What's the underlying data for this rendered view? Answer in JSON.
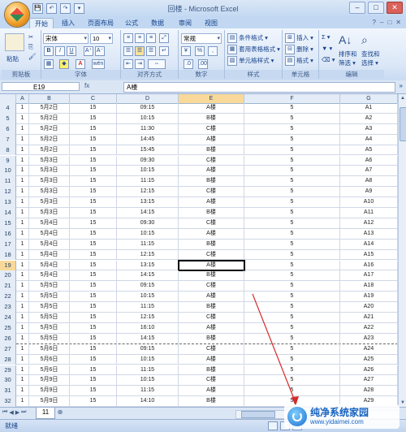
{
  "window": {
    "title": "回楼 - Microsoft Excel"
  },
  "qat": [
    "💾",
    "↶",
    "↷",
    "▾"
  ],
  "window_buttons": [
    "–",
    "□",
    "✕"
  ],
  "tabs": [
    "开始",
    "插入",
    "页面布局",
    "公式",
    "数据",
    "审阅",
    "视图"
  ],
  "active_tab": "开始",
  "tab_icons": [
    "?",
    "–",
    "□",
    "✕"
  ],
  "ribbon": {
    "clipboard": {
      "label": "剪贴板",
      "paste": "粘贴"
    },
    "font": {
      "label": "字体",
      "font_name": "宋体",
      "font_size": "10",
      "bold": "B",
      "italic": "I",
      "underline": "U",
      "grow": "A⁺",
      "shrink": "A⁻",
      "font_color": "A",
      "pinyin": "wén"
    },
    "alignment": {
      "label": "对齐方式"
    },
    "number": {
      "label": "数字",
      "format": "常规",
      "percent": "%",
      "comma": ","
    },
    "styles": {
      "label": "样式",
      "conditional": "条件格式 ▾",
      "table": "套用表格格式 ▾",
      "cell_styles": "单元格样式 ▾"
    },
    "cells": {
      "label": "单元格",
      "insert": "插入 ▾",
      "delete": "删除 ▾",
      "format": "格式 ▾"
    },
    "editing": {
      "label": "编辑",
      "sum": "Σ ▾",
      "sort": "排序和\n筛选 ▾",
      "find": "查找和\n选择 ▾",
      "sort_l1": "排序和",
      "sort_l2": "筛选 ▾",
      "find_l1": "查找和",
      "find_l2": "选择 ▾"
    }
  },
  "formula_bar": {
    "name_box": "E19",
    "fx": "fx",
    "content": "A楼"
  },
  "columns": [
    "A",
    "B",
    "C",
    "D",
    "E",
    "F",
    "G"
  ],
  "selected_column": "E",
  "selected_row": "19",
  "rows": [
    {
      "n": "4",
      "a": "1",
      "b": "5月2日",
      "c": "15",
      "d": "09:15",
      "e": "A楼",
      "f": "5",
      "g": "A1"
    },
    {
      "n": "5",
      "a": "1",
      "b": "5月2日",
      "c": "15",
      "d": "10:15",
      "e": "B楼",
      "f": "5",
      "g": "A2"
    },
    {
      "n": "6",
      "a": "1",
      "b": "5月2日",
      "c": "15",
      "d": "11:30",
      "e": "C楼",
      "f": "5",
      "g": "A3"
    },
    {
      "n": "7",
      "a": "1",
      "b": "5月2日",
      "c": "15",
      "d": "14:45",
      "e": "A楼",
      "f": "5",
      "g": "A4"
    },
    {
      "n": "8",
      "a": "1",
      "b": "5月2日",
      "c": "15",
      "d": "15:45",
      "e": "B楼",
      "f": "5",
      "g": "A5"
    },
    {
      "n": "9",
      "a": "1",
      "b": "5月3日",
      "c": "15",
      "d": "09:30",
      "e": "C楼",
      "f": "5",
      "g": "A6"
    },
    {
      "n": "10",
      "a": "1",
      "b": "5月3日",
      "c": "15",
      "d": "10:15",
      "e": "A楼",
      "f": "5",
      "g": "A7"
    },
    {
      "n": "11",
      "a": "1",
      "b": "5月3日",
      "c": "15",
      "d": "11:15",
      "e": "B楼",
      "f": "5",
      "g": "A8"
    },
    {
      "n": "12",
      "a": "1",
      "b": "5月3日",
      "c": "15",
      "d": "12:15",
      "e": "C楼",
      "f": "5",
      "g": "A9"
    },
    {
      "n": "13",
      "a": "1",
      "b": "5月3日",
      "c": "15",
      "d": "13:15",
      "e": "A楼",
      "f": "5",
      "g": "A10"
    },
    {
      "n": "14",
      "a": "1",
      "b": "5月3日",
      "c": "15",
      "d": "14:15",
      "e": "B楼",
      "f": "5",
      "g": "A11"
    },
    {
      "n": "15",
      "a": "1",
      "b": "5月4日",
      "c": "15",
      "d": "09:30",
      "e": "C楼",
      "f": "5",
      "g": "A12"
    },
    {
      "n": "16",
      "a": "1",
      "b": "5月4日",
      "c": "15",
      "d": "10:15",
      "e": "A楼",
      "f": "5",
      "g": "A13"
    },
    {
      "n": "17",
      "a": "1",
      "b": "5月4日",
      "c": "15",
      "d": "11:15",
      "e": "B楼",
      "f": "5",
      "g": "A14"
    },
    {
      "n": "18",
      "a": "1",
      "b": "5月4日",
      "c": "15",
      "d": "12:15",
      "e": "C楼",
      "f": "5",
      "g": "A15"
    },
    {
      "n": "19",
      "a": "1",
      "b": "5月4日",
      "c": "15",
      "d": "13:15",
      "e": "A楼",
      "f": "5",
      "g": "A16"
    },
    {
      "n": "20",
      "a": "1",
      "b": "5月4日",
      "c": "15",
      "d": "14:15",
      "e": "B楼",
      "f": "5",
      "g": "A17"
    },
    {
      "n": "21",
      "a": "1",
      "b": "5月5日",
      "c": "15",
      "d": "09:15",
      "e": "C楼",
      "f": "5",
      "g": "A18"
    },
    {
      "n": "22",
      "a": "1",
      "b": "5月5日",
      "c": "15",
      "d": "10:15",
      "e": "A楼",
      "f": "5",
      "g": "A19"
    },
    {
      "n": "23",
      "a": "1",
      "b": "5月5日",
      "c": "15",
      "d": "11:15",
      "e": "B楼",
      "f": "5",
      "g": "A20"
    },
    {
      "n": "24",
      "a": "1",
      "b": "5月5日",
      "c": "15",
      "d": "12:15",
      "e": "C楼",
      "f": "5",
      "g": "A21"
    },
    {
      "n": "25",
      "a": "1",
      "b": "5月5日",
      "c": "15",
      "d": "16:10",
      "e": "A楼",
      "f": "5",
      "g": "A22"
    },
    {
      "n": "26",
      "a": "1",
      "b": "5月5日",
      "c": "15",
      "d": "14:15",
      "e": "B楼",
      "f": "5",
      "g": "A23"
    },
    {
      "n": "27",
      "a": "1",
      "b": "5月6日",
      "c": "15",
      "d": "09:15",
      "e": "C楼",
      "f": "5",
      "g": "A24"
    },
    {
      "n": "28",
      "a": "1",
      "b": "5月6日",
      "c": "15",
      "d": "10:15",
      "e": "A楼",
      "f": "5",
      "g": "A25"
    },
    {
      "n": "29",
      "a": "1",
      "b": "5月6日",
      "c": "15",
      "d": "11:15",
      "e": "B楼",
      "f": "5",
      "g": "A26"
    },
    {
      "n": "30",
      "a": "1",
      "b": "5月9日",
      "c": "15",
      "d": "10:15",
      "e": "C楼",
      "f": "5",
      "g": "A27"
    },
    {
      "n": "31",
      "a": "1",
      "b": "5月9日",
      "c": "15",
      "d": "11:15",
      "e": "A楼",
      "f": "5",
      "g": "A28"
    },
    {
      "n": "32",
      "a": "1",
      "b": "5月9日",
      "c": "15",
      "d": "14:10",
      "e": "B楼",
      "f": "5",
      "g": "A29"
    }
  ],
  "dashed_row": "26",
  "sheet_tab": "11",
  "status": "就绪",
  "watermark": {
    "title": "纯净系统家园",
    "url": "www.yidaimei.com"
  },
  "colors": {
    "accent": "#c2d8f2",
    "selection": "#f9d99a",
    "arrow": "#d62a2a"
  }
}
